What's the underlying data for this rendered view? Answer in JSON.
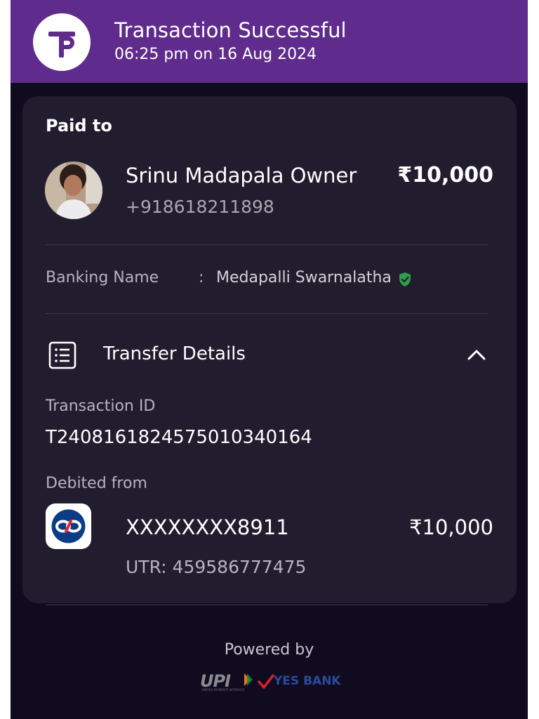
{
  "header": {
    "title": "Transaction Successful",
    "datetime": "06:25 pm on 16 Aug 2024",
    "logo_icon": "phonepe-logo-icon",
    "bg_color": "#5f2b8c"
  },
  "payee": {
    "section_label": "Paid to",
    "name": "Srinu Madapala Owner",
    "phone": "+918618211898",
    "amount": "₹10,000"
  },
  "banking": {
    "label": "Banking Name",
    "separator": ":",
    "value": "Medapalli Swarnalatha",
    "verified_icon": "verified-shield-icon",
    "verified_color": "#2e9e47"
  },
  "transfer": {
    "title": "Transfer Details",
    "icon": "receipt-list-icon",
    "toggle_icon": "chevron-up-icon",
    "transaction_id_label": "Transaction ID",
    "transaction_id": "T2408161824575010340164",
    "debited_from_label": "Debited from",
    "bank_icon": "kotak-bank-logo-icon",
    "account_number": "XXXXXXXX8911",
    "debit_amount": "₹10,000",
    "utr": "UTR: 459586777475"
  },
  "footer": {
    "powered_by": "Powered by",
    "upi_logo_text": "UPI",
    "upi_tagline": "UNIFIED PAYMENTS INTERFACE",
    "bank_logo_text": "YES BANK"
  }
}
